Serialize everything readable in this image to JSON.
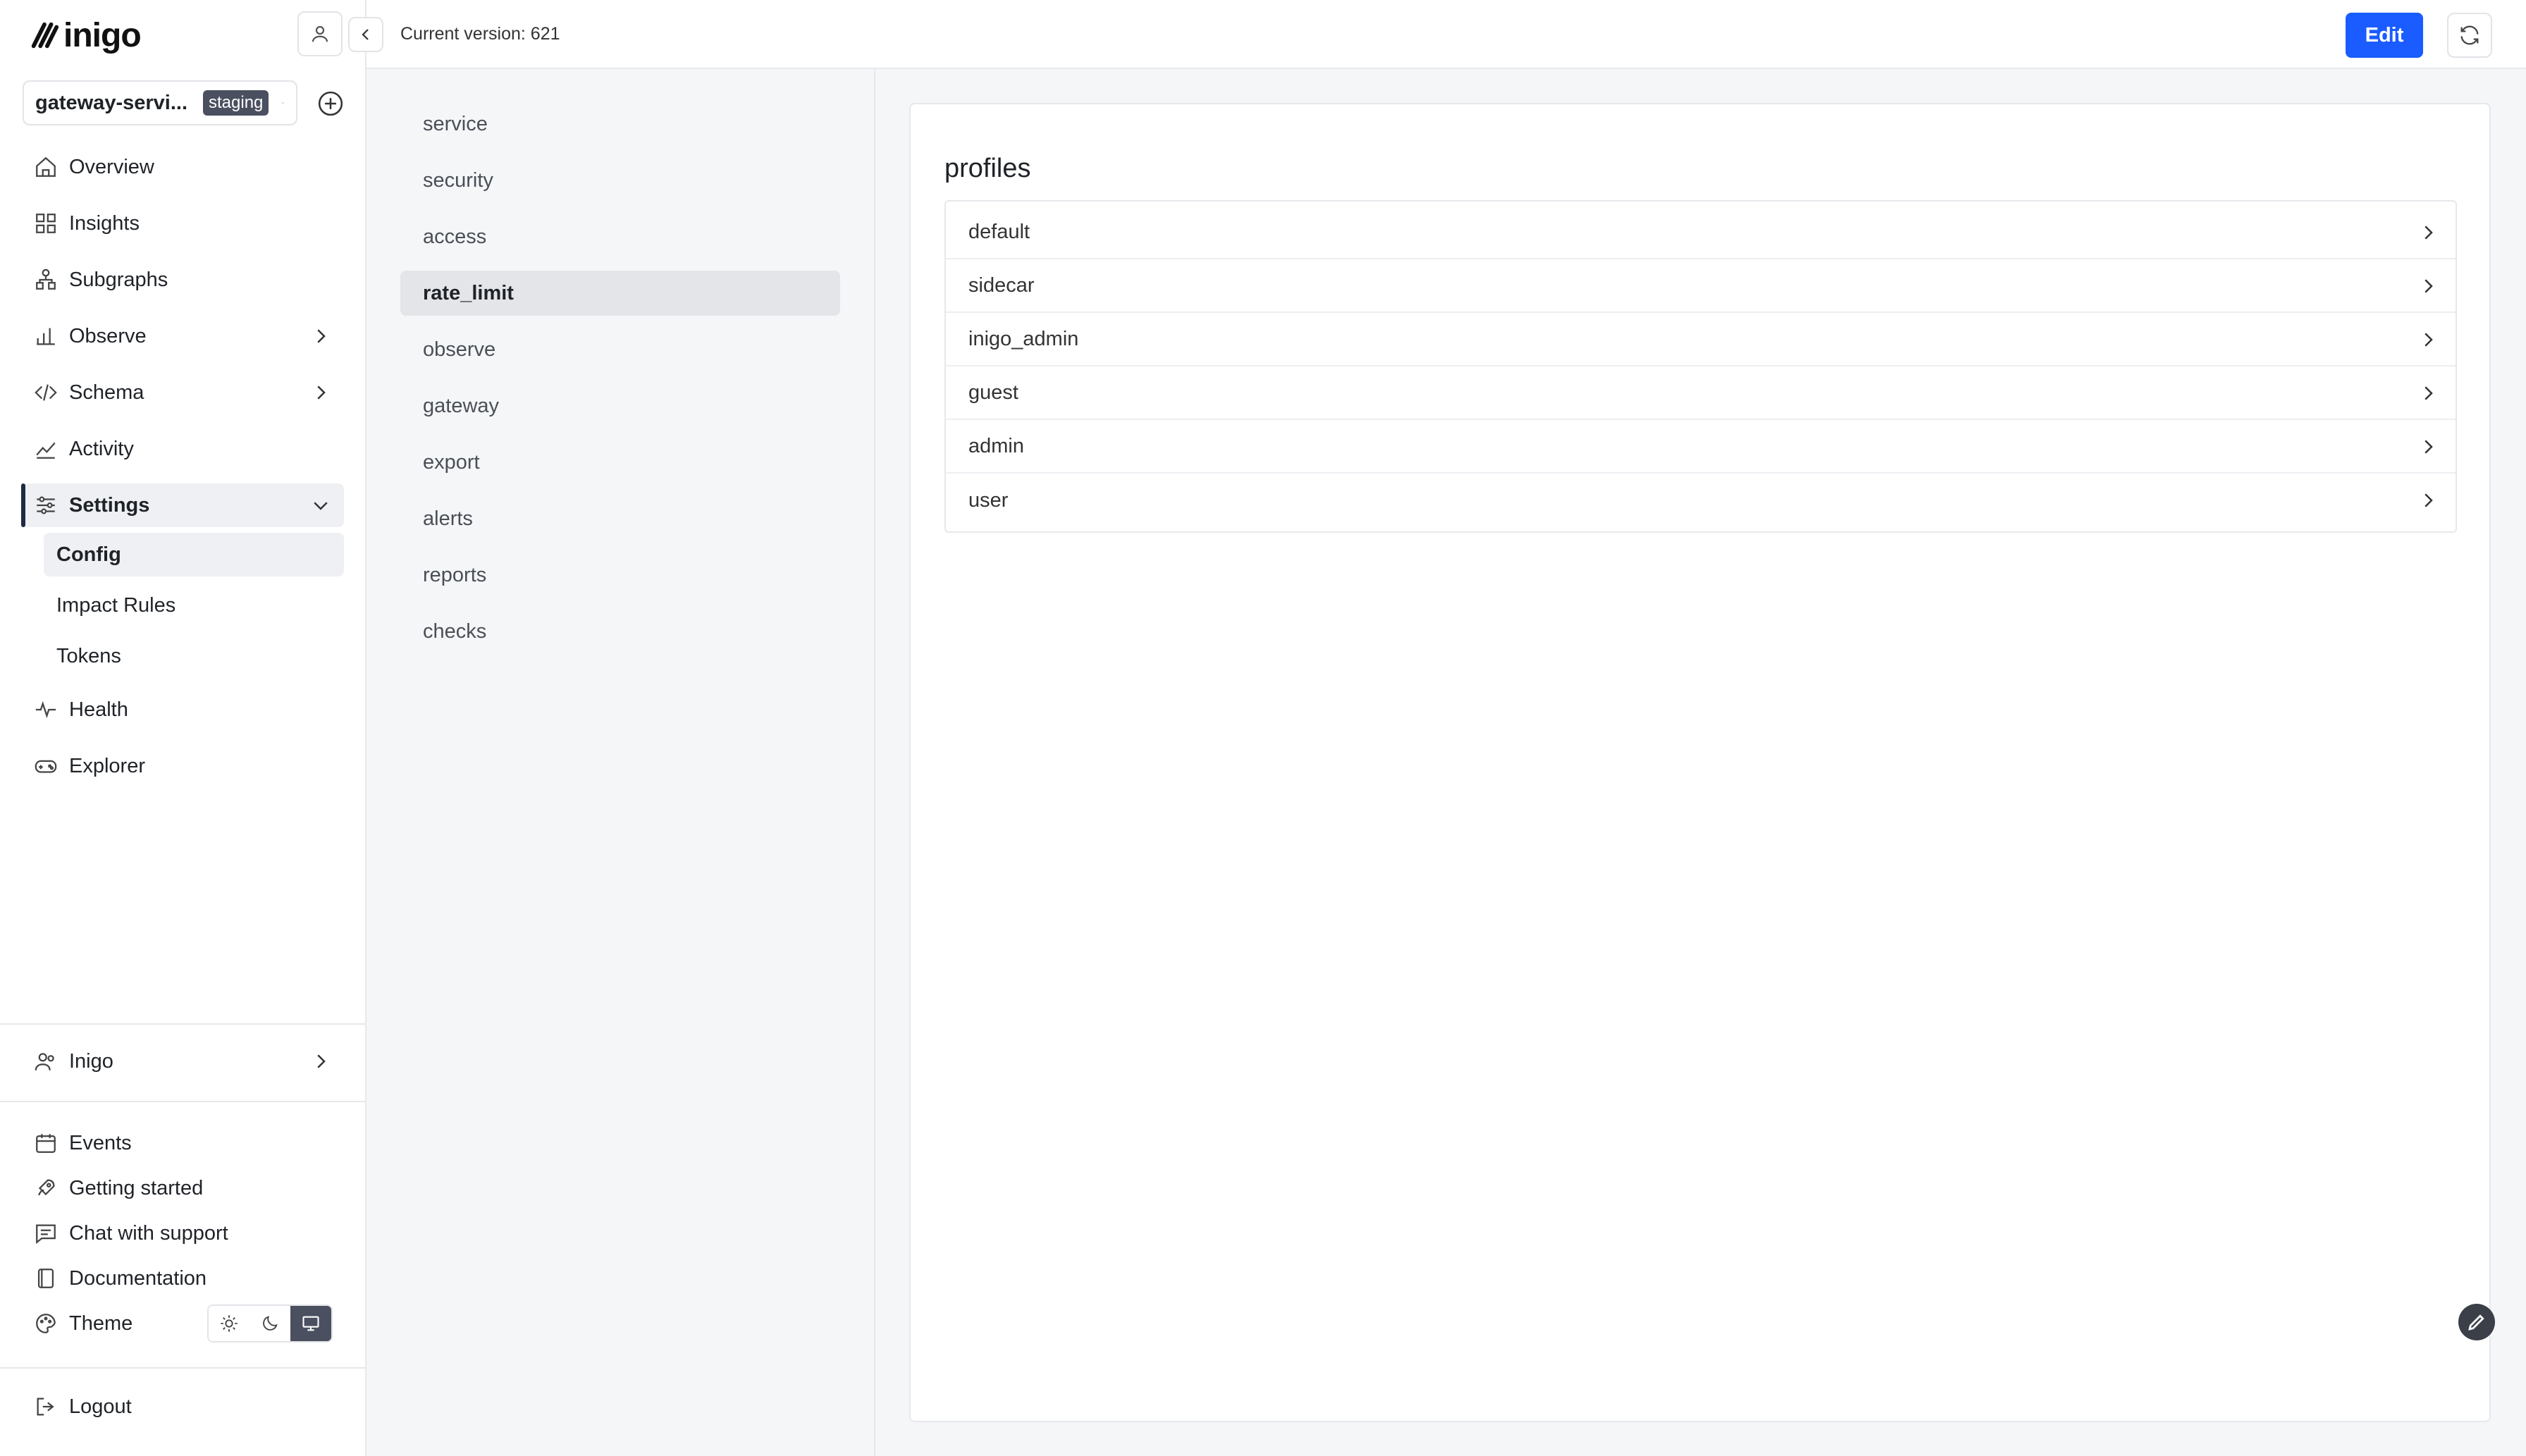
{
  "brand": {
    "name": "inigo"
  },
  "service_selector": {
    "name": "gateway-servi...",
    "badge": "staging"
  },
  "nav": {
    "items": [
      {
        "label": "Overview"
      },
      {
        "label": "Insights"
      },
      {
        "label": "Subgraphs"
      },
      {
        "label": "Observe"
      },
      {
        "label": "Schema"
      },
      {
        "label": "Activity"
      },
      {
        "label": "Settings"
      }
    ],
    "settings_sub": [
      {
        "label": "Config"
      },
      {
        "label": "Impact Rules"
      },
      {
        "label": "Tokens"
      }
    ],
    "after": [
      {
        "label": "Health"
      },
      {
        "label": "Explorer"
      }
    ]
  },
  "org": {
    "label": "Inigo"
  },
  "footer": {
    "events": "Events",
    "getting_started": "Getting started",
    "chat": "Chat with support",
    "docs": "Documentation",
    "theme": "Theme",
    "logout": "Logout"
  },
  "topbar": {
    "version": "Current version: 621",
    "edit_label": "Edit"
  },
  "sections": [
    {
      "label": "service"
    },
    {
      "label": "security"
    },
    {
      "label": "access"
    },
    {
      "label": "rate_limit"
    },
    {
      "label": "observe"
    },
    {
      "label": "gateway"
    },
    {
      "label": "export"
    },
    {
      "label": "alerts"
    },
    {
      "label": "reports"
    },
    {
      "label": "checks"
    }
  ],
  "main": {
    "title": "profiles",
    "profiles": [
      {
        "label": "default"
      },
      {
        "label": "sidecar"
      },
      {
        "label": "inigo_admin"
      },
      {
        "label": "guest"
      },
      {
        "label": "admin"
      },
      {
        "label": "user"
      }
    ]
  },
  "colors": {
    "accent": "#1a5cff",
    "badge": "#4b5060",
    "active_bar": "#1f2a44"
  }
}
